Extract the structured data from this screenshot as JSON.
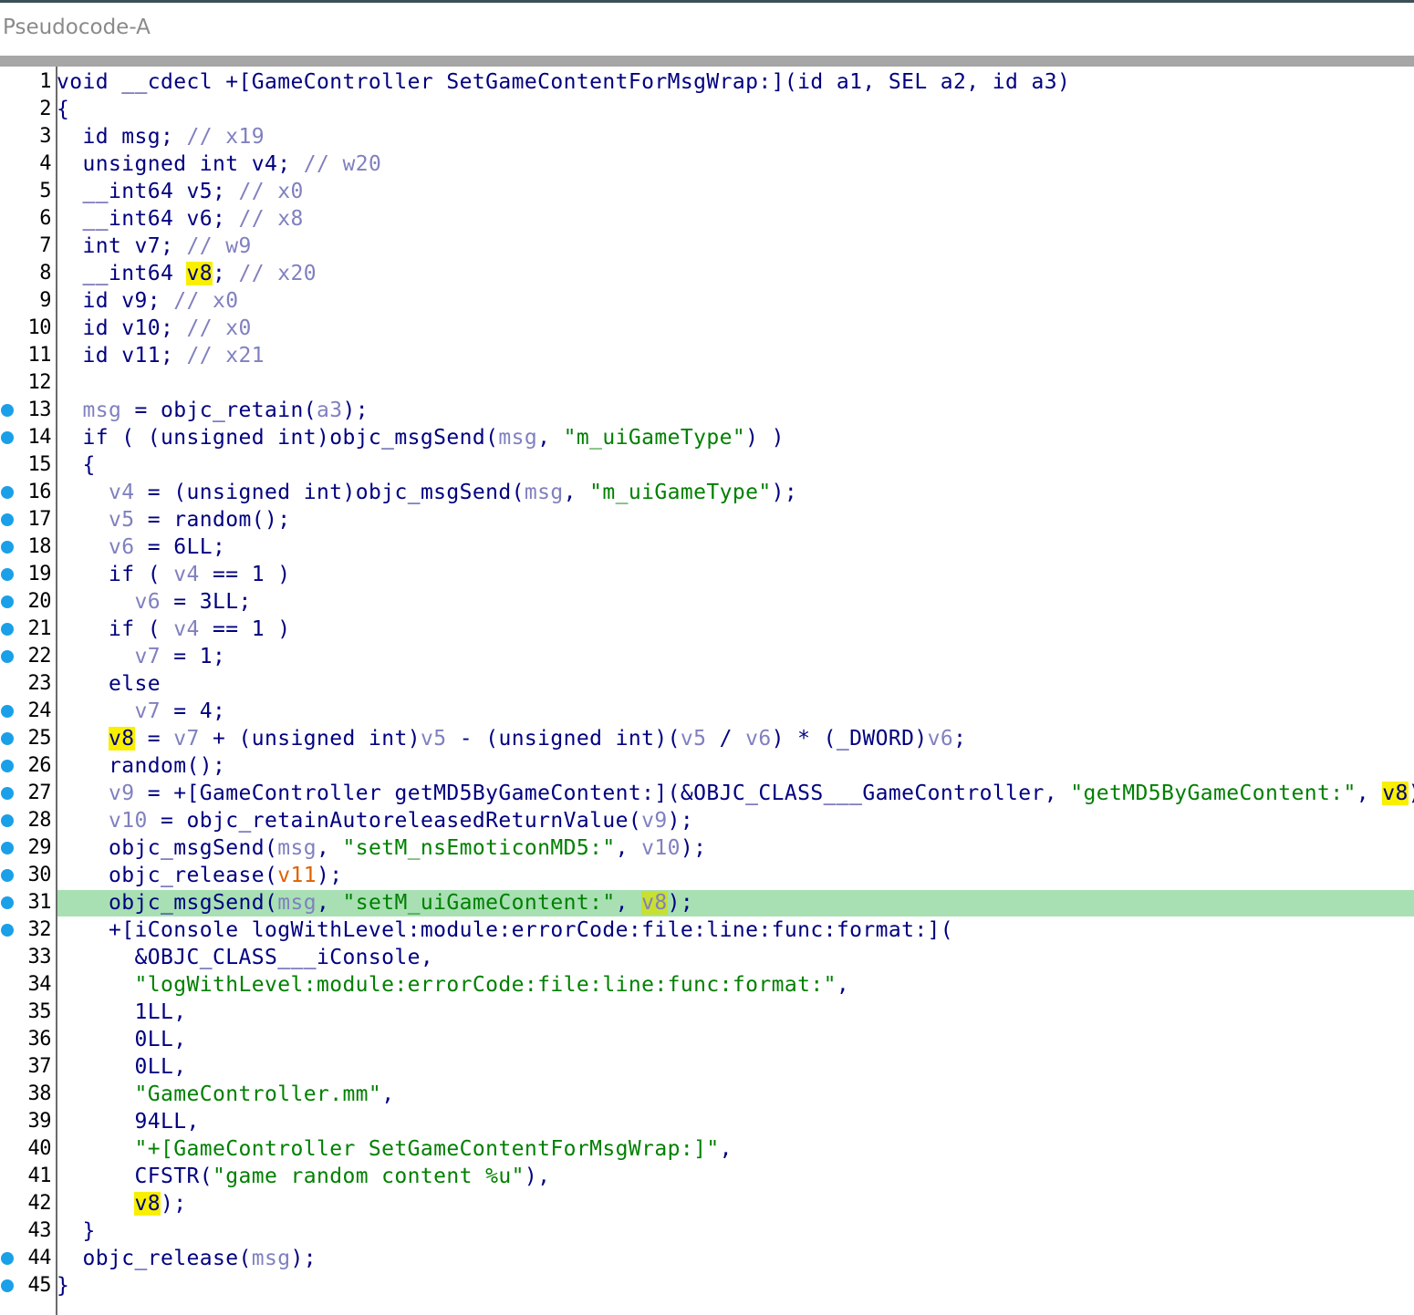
{
  "window": {
    "title": "Pseudocode-A"
  },
  "editor": {
    "current_line": 31,
    "lines": [
      {
        "n": "1",
        "bp": false,
        "tokens": [
          [
            "kw",
            "void __cdecl +[GameController SetGameContentForMsgWrap:](id a1, SEL a2, id a3)"
          ]
        ]
      },
      {
        "n": "2",
        "bp": false,
        "tokens": [
          [
            "kw",
            "{"
          ]
        ]
      },
      {
        "n": "3",
        "bp": false,
        "tokens": [
          [
            "kw",
            "  id msg; "
          ],
          [
            "cmt",
            "// x19"
          ]
        ]
      },
      {
        "n": "4",
        "bp": false,
        "tokens": [
          [
            "kw",
            "  unsigned int v4; "
          ],
          [
            "cmt",
            "// w20"
          ]
        ]
      },
      {
        "n": "5",
        "bp": false,
        "tokens": [
          [
            "kw",
            "  __int64 v5; "
          ],
          [
            "cmt",
            "// x0"
          ]
        ]
      },
      {
        "n": "6",
        "bp": false,
        "tokens": [
          [
            "kw",
            "  __int64 v6; "
          ],
          [
            "cmt",
            "// x8"
          ]
        ]
      },
      {
        "n": "7",
        "bp": false,
        "tokens": [
          [
            "kw",
            "  int v7; "
          ],
          [
            "cmt",
            "// w9"
          ]
        ]
      },
      {
        "n": "8",
        "bp": false,
        "tokens": [
          [
            "kw",
            "  __int64 "
          ],
          [
            "v8",
            "v8"
          ],
          [
            "kw",
            "; "
          ],
          [
            "cmt",
            "// x20"
          ]
        ]
      },
      {
        "n": "9",
        "bp": false,
        "tokens": [
          [
            "kw",
            "  id v9; "
          ],
          [
            "cmt",
            "// x0"
          ]
        ]
      },
      {
        "n": "10",
        "bp": false,
        "tokens": [
          [
            "kw",
            "  id v10; "
          ],
          [
            "cmt",
            "// x0"
          ]
        ]
      },
      {
        "n": "11",
        "bp": false,
        "tokens": [
          [
            "kw",
            "  id v11; "
          ],
          [
            "cmt",
            "// x21"
          ]
        ]
      },
      {
        "n": "12",
        "bp": false,
        "tokens": []
      },
      {
        "n": "13",
        "bp": true,
        "tokens": [
          [
            "kw",
            "  "
          ],
          [
            "var",
            "msg"
          ],
          [
            "kw",
            " = objc_retain("
          ],
          [
            "var",
            "a3"
          ],
          [
            "kw",
            ");"
          ]
        ]
      },
      {
        "n": "14",
        "bp": true,
        "tokens": [
          [
            "kw",
            "  if ( (unsigned int)objc_msgSend("
          ],
          [
            "var",
            "msg"
          ],
          [
            "kw",
            ", "
          ],
          [
            "str",
            "\"m_uiGameType\""
          ],
          [
            "kw",
            ") )"
          ]
        ]
      },
      {
        "n": "15",
        "bp": false,
        "tokens": [
          [
            "kw",
            "  {"
          ]
        ]
      },
      {
        "n": "16",
        "bp": true,
        "tokens": [
          [
            "kw",
            "    "
          ],
          [
            "var",
            "v4"
          ],
          [
            "kw",
            " = (unsigned int)objc_msgSend("
          ],
          [
            "var",
            "msg"
          ],
          [
            "kw",
            ", "
          ],
          [
            "str",
            "\"m_uiGameType\""
          ],
          [
            "kw",
            ");"
          ]
        ]
      },
      {
        "n": "17",
        "bp": true,
        "tokens": [
          [
            "kw",
            "    "
          ],
          [
            "var",
            "v5"
          ],
          [
            "kw",
            " = random();"
          ]
        ]
      },
      {
        "n": "18",
        "bp": true,
        "tokens": [
          [
            "kw",
            "    "
          ],
          [
            "var",
            "v6"
          ],
          [
            "kw",
            " = 6LL;"
          ]
        ]
      },
      {
        "n": "19",
        "bp": true,
        "tokens": [
          [
            "kw",
            "    if ( "
          ],
          [
            "var",
            "v4"
          ],
          [
            "kw",
            " == 1 )"
          ]
        ]
      },
      {
        "n": "20",
        "bp": true,
        "tokens": [
          [
            "kw",
            "      "
          ],
          [
            "var",
            "v6"
          ],
          [
            "kw",
            " = 3LL;"
          ]
        ]
      },
      {
        "n": "21",
        "bp": true,
        "tokens": [
          [
            "kw",
            "    if ( "
          ],
          [
            "var",
            "v4"
          ],
          [
            "kw",
            " == 1 )"
          ]
        ]
      },
      {
        "n": "22",
        "bp": true,
        "tokens": [
          [
            "kw",
            "      "
          ],
          [
            "var",
            "v7"
          ],
          [
            "kw",
            " = 1;"
          ]
        ]
      },
      {
        "n": "23",
        "bp": false,
        "tokens": [
          [
            "kw",
            "    else"
          ]
        ]
      },
      {
        "n": "24",
        "bp": true,
        "tokens": [
          [
            "kw",
            "      "
          ],
          [
            "var",
            "v7"
          ],
          [
            "kw",
            " = 4;"
          ]
        ]
      },
      {
        "n": "25",
        "bp": true,
        "tokens": [
          [
            "kw",
            "    "
          ],
          [
            "v8",
            "v8"
          ],
          [
            "kw",
            " = "
          ],
          [
            "var",
            "v7"
          ],
          [
            "kw",
            " + (unsigned int)"
          ],
          [
            "var",
            "v5"
          ],
          [
            "kw",
            " - (unsigned int)("
          ],
          [
            "var",
            "v5"
          ],
          [
            "kw",
            " / "
          ],
          [
            "var",
            "v6"
          ],
          [
            "kw",
            ") * (_DWORD)"
          ],
          [
            "var",
            "v6"
          ],
          [
            "kw",
            ";"
          ]
        ]
      },
      {
        "n": "26",
        "bp": true,
        "tokens": [
          [
            "kw",
            "    random();"
          ]
        ]
      },
      {
        "n": "27",
        "bp": true,
        "tokens": [
          [
            "kw",
            "    "
          ],
          [
            "var",
            "v9"
          ],
          [
            "kw",
            " = +[GameController getMD5ByGameContent:](&OBJC_CLASS___GameController, "
          ],
          [
            "str",
            "\"getMD5ByGameContent:\""
          ],
          [
            "kw",
            ", "
          ],
          [
            "v8",
            "v8"
          ],
          [
            "kw",
            ");"
          ]
        ]
      },
      {
        "n": "28",
        "bp": true,
        "tokens": [
          [
            "kw",
            "    "
          ],
          [
            "var",
            "v10"
          ],
          [
            "kw",
            " = objc_retainAutoreleasedReturnValue("
          ],
          [
            "var",
            "v9"
          ],
          [
            "kw",
            ");"
          ]
        ]
      },
      {
        "n": "29",
        "bp": true,
        "tokens": [
          [
            "kw",
            "    objc_msgSend("
          ],
          [
            "var",
            "msg"
          ],
          [
            "kw",
            ", "
          ],
          [
            "str",
            "\"setM_nsEmoticonMD5:\""
          ],
          [
            "kw",
            ", "
          ],
          [
            "var",
            "v10"
          ],
          [
            "kw",
            ");"
          ]
        ]
      },
      {
        "n": "30",
        "bp": true,
        "tokens": [
          [
            "kw",
            "    objc_release("
          ],
          [
            "org",
            "v11"
          ],
          [
            "kw",
            ");"
          ]
        ]
      },
      {
        "n": "31",
        "bp": true,
        "tokens": [
          [
            "kw",
            "    objc_msgSend("
          ],
          [
            "var",
            "msg"
          ],
          [
            "kw",
            ", "
          ],
          [
            "str",
            "\"setM_uiGameContent:\""
          ],
          [
            "kw",
            ", "
          ],
          [
            "v8c",
            "v8"
          ],
          [
            "kw",
            ");"
          ]
        ]
      },
      {
        "n": "32",
        "bp": true,
        "tokens": [
          [
            "kw",
            "    +[iConsole logWithLevel:module:errorCode:file:line:func:format:]("
          ]
        ]
      },
      {
        "n": "33",
        "bp": false,
        "tokens": [
          [
            "kw",
            "      &OBJC_CLASS___iConsole,"
          ]
        ]
      },
      {
        "n": "34",
        "bp": false,
        "tokens": [
          [
            "kw",
            "      "
          ],
          [
            "str",
            "\"logWithLevel:module:errorCode:file:line:func:format:\""
          ],
          [
            "kw",
            ","
          ]
        ]
      },
      {
        "n": "35",
        "bp": false,
        "tokens": [
          [
            "kw",
            "      1LL,"
          ]
        ]
      },
      {
        "n": "36",
        "bp": false,
        "tokens": [
          [
            "kw",
            "      0LL,"
          ]
        ]
      },
      {
        "n": "37",
        "bp": false,
        "tokens": [
          [
            "kw",
            "      0LL,"
          ]
        ]
      },
      {
        "n": "38",
        "bp": false,
        "tokens": [
          [
            "kw",
            "      "
          ],
          [
            "str",
            "\"GameController.mm\""
          ],
          [
            "kw",
            ","
          ]
        ]
      },
      {
        "n": "39",
        "bp": false,
        "tokens": [
          [
            "kw",
            "      94LL,"
          ]
        ]
      },
      {
        "n": "40",
        "bp": false,
        "tokens": [
          [
            "kw",
            "      "
          ],
          [
            "str",
            "\"+[GameController SetGameContentForMsgWrap:]\""
          ],
          [
            "kw",
            ","
          ]
        ]
      },
      {
        "n": "41",
        "bp": false,
        "tokens": [
          [
            "kw",
            "      CFSTR("
          ],
          [
            "str",
            "\"game random content %u\""
          ],
          [
            "kw",
            "),"
          ]
        ]
      },
      {
        "n": "42",
        "bp": false,
        "tokens": [
          [
            "kw",
            "      "
          ],
          [
            "v8",
            "v8"
          ],
          [
            "kw",
            ");"
          ]
        ]
      },
      {
        "n": "43",
        "bp": false,
        "tokens": [
          [
            "kw",
            "  }"
          ]
        ]
      },
      {
        "n": "44",
        "bp": true,
        "tokens": [
          [
            "kw",
            "  objc_release("
          ],
          [
            "var",
            "msg"
          ],
          [
            "kw",
            ");"
          ]
        ]
      },
      {
        "n": "45",
        "bp": true,
        "tokens": [
          [
            "kw",
            "}"
          ]
        ]
      }
    ]
  },
  "colors": {
    "keyword": "#000080",
    "variable": "#8080c0",
    "string": "#008000",
    "orange": "#e06000",
    "highlight_yellow": "#f8f000",
    "current_line": "#a8e0b4",
    "breakpoint": "#1aa0e8"
  },
  "icons": {
    "breakpoint": "breakpoint-dot-icon"
  }
}
